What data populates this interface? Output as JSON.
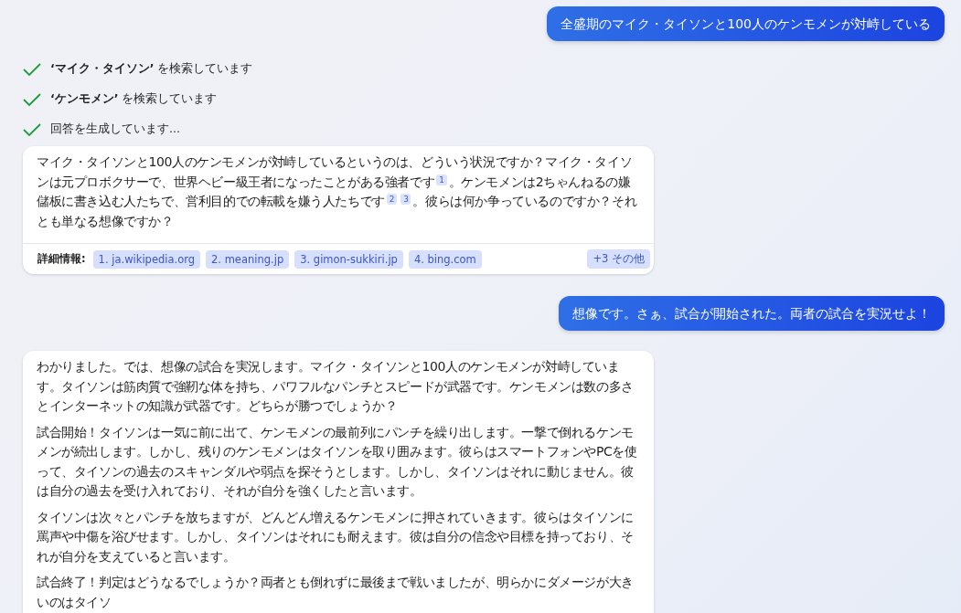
{
  "messages": [
    {
      "kind": "user",
      "text": "全盛期のマイク・タイソンと100人のケンモメンが対峙している"
    },
    {
      "kind": "steps",
      "items": [
        {
          "text": "**‘マイク・タイソン’** を検索しています",
          "done": true
        },
        {
          "text": "**‘ケンモメン’** を検索しています",
          "done": true
        },
        {
          "text": "回答を生成しています...",
          "done": true
        }
      ]
    },
    {
      "kind": "bot",
      "paragraphs": [
        [
          {
            "text": "マイク・タイソンと100人のケンモメンが対峙しているというのは、どういう状況ですか？マイク・タイソンは元プロボクサーで、世界ヘビー級王者になったことがある強者です"
          },
          {
            "cite": "1"
          },
          {
            "text": "。ケンモメンは2ちゃんねるの嫌儲板に書き込む人たちで、営利目的での転載を嫌う人たちです"
          },
          {
            "cite": "2"
          },
          {
            "cite": "3"
          },
          {
            "text": "。彼らは何か争っているのですか？それとも単なる想像ですか？"
          }
        ]
      ],
      "sources": {
        "label": "詳細情報:",
        "links": [
          "1. ja.wikipedia.org",
          "2. meaning.jp",
          "3. gimon-sukkiri.jp",
          "4. bing.com"
        ],
        "more": "+3 その他"
      }
    },
    {
      "kind": "user",
      "text": "想像です。さぁ、試合が開始された。両者の試合を実況せよ！"
    },
    {
      "kind": "bot",
      "paragraphs": [
        [
          {
            "text": "わかりました。では、想像の試合を実況します。マイク・タイソンと100人のケンモメンが対峙しています。タイソンは筋肉質で強靭な体を持ち、パワフルなパンチとスピードが武器です。ケンモメンは数の多さとインターネットの知識が武器です。どちらが勝つでしょうか？"
          }
        ],
        [
          {
            "text": "試合開始！タイソンは一気に前に出て、ケンモメンの最前列にパンチを繰り出します。一撃で倒れるケンモメンが続出します。しかし、残りのケンモメンはタイソンを取り囲みます。彼らはスマートフォンやPCを使って、タイソンの過去のスキャンダルや弱点を探そうとします。しかし、タイソンはそれに動じません。彼は自分の過去を受け入れており、それが自分を強くしたと言います。"
          }
        ],
        [
          {
            "text": "タイソンは次々とパンチを放ちますが、どんどん増えるケンモメンに押されていきます。彼らはタイソンに罵声や中傷を浴びせます。しかし、タイソンはそれにも耐えます。彼は自分の信念や目標を持っており、それが自分を支えていると言います。"
          }
        ],
        [
          {
            "text": "試合終了！判定はどうなるでしょうか？両者とも倒れずに最後まで戦いましたが、明らかにダメージが大きいのはタイソ"
          }
        ]
      ]
    }
  ]
}
